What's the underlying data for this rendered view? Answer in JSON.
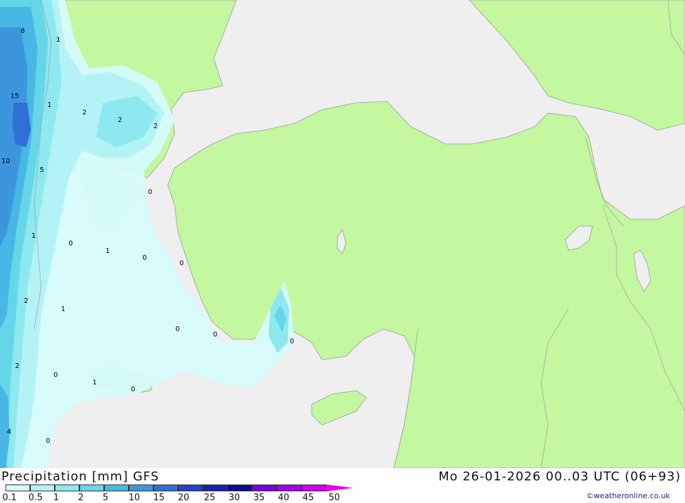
{
  "title": "Precipitation [mm] GFS",
  "datetime": "Mo 26-01-2026 00..03 UTC (06+93)",
  "credit": "©weatheronline.co.uk",
  "colors": {
    "sea": "#efefef",
    "land": "#c3f7a0",
    "border": "#9a9a9a"
  },
  "legend": {
    "ticks": [
      "0.1",
      "0.5",
      "1",
      "2",
      "5",
      "10",
      "15",
      "20",
      "25",
      "30",
      "35",
      "40",
      "45",
      "50"
    ],
    "colors": [
      "#d6fbfb",
      "#b4f3f5",
      "#8ee8ef",
      "#64d6e8",
      "#47b8e6",
      "#3c96de",
      "#2f6fd6",
      "#2244c5",
      "#1722a8",
      "#0b0b93",
      "#7a00e0",
      "#a000e8",
      "#cc00ee",
      "#ee00ee",
      "#c800a8"
    ]
  },
  "contour_labels": [
    "8",
    "1",
    "15",
    "1",
    "2",
    "2",
    "2",
    "10",
    "5",
    "0",
    "1",
    "0",
    "1",
    "0",
    "0",
    "2",
    "1",
    "0",
    "0",
    "0",
    "2",
    "0",
    "1",
    "0",
    "4",
    "0"
  ]
}
